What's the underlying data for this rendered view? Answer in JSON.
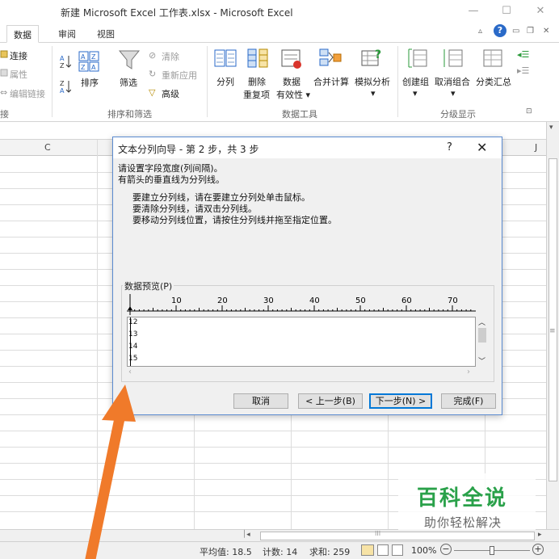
{
  "window": {
    "title": "新建 Microsoft Excel 工作表.xlsx - Microsoft Excel",
    "minimize": "—",
    "maximize": "☐",
    "close": "✕"
  },
  "ribbon_tabs": [
    "数据",
    "审阅",
    "视图"
  ],
  "ribbon_right": {
    "help": "?",
    "min": "▭",
    "restore": "🗗",
    "close": "✕"
  },
  "ribbon": {
    "connections": {
      "items": [
        "连接",
        "属性",
        "编辑链接"
      ],
      "group": "接"
    },
    "sort_filter": {
      "sort_asc": "A↓Z",
      "sort_desc": "Z↓A",
      "sort": "排序",
      "filter": "筛选",
      "clear": "清除",
      "reapply": "重新应用",
      "advanced": "高级",
      "group": "排序和筛选"
    },
    "data_tools": {
      "text_to_columns": "分列",
      "remove_dup_1": "删除",
      "remove_dup_2": "重复项",
      "validation_1": "数据",
      "validation_2": "有效性 ▾",
      "consolidate": "合并计算",
      "whatif": "模拟分析",
      "whatif_arrow": "▾",
      "group": "数据工具"
    },
    "outline": {
      "group_btn": "创建组",
      "ungroup": "取消组合",
      "subtotal": "分类汇总",
      "arrow": "▾",
      "group": "分级显示",
      "launcher": "⊡"
    }
  },
  "sheet": {
    "col_c": "C",
    "col_j": "J"
  },
  "dialog": {
    "title": "文本分列向导 - 第 2 步，共 3 步",
    "help": "?",
    "close": "✕",
    "line1": "请设置字段宽度(列间隔)。",
    "line2": "有箭头的垂直线为分列线。",
    "hint1": "要建立分列线，请在要建立分列处单击鼠标。",
    "hint2": "要清除分列线，请双击分列线。",
    "hint3": "要移动分列线位置，请按住分列线并拖至指定位置。",
    "preview_label": "数据预览(P)",
    "ruler_ticks": [
      "10",
      "20",
      "30",
      "40",
      "50",
      "60",
      "70"
    ],
    "preview_rows": [
      "12",
      "13",
      "14",
      "15"
    ],
    "buttons": {
      "cancel": "取消",
      "back": "< 上一步(B)",
      "next": "下一步(N) >",
      "finish": "完成(F)"
    }
  },
  "status": {
    "average": "平均值: 18.5",
    "count": "计数: 14",
    "sum": "求和: 259",
    "zoom": "100%",
    "zoom_minus": "−",
    "zoom_plus": "+"
  },
  "watermark": {
    "title": "百科全说",
    "subtitle": "助你轻松解决"
  },
  "colors": {
    "accent": "#2a6ac8",
    "arrow": "#f07a2a",
    "watermark_green": "#2aa14a"
  }
}
